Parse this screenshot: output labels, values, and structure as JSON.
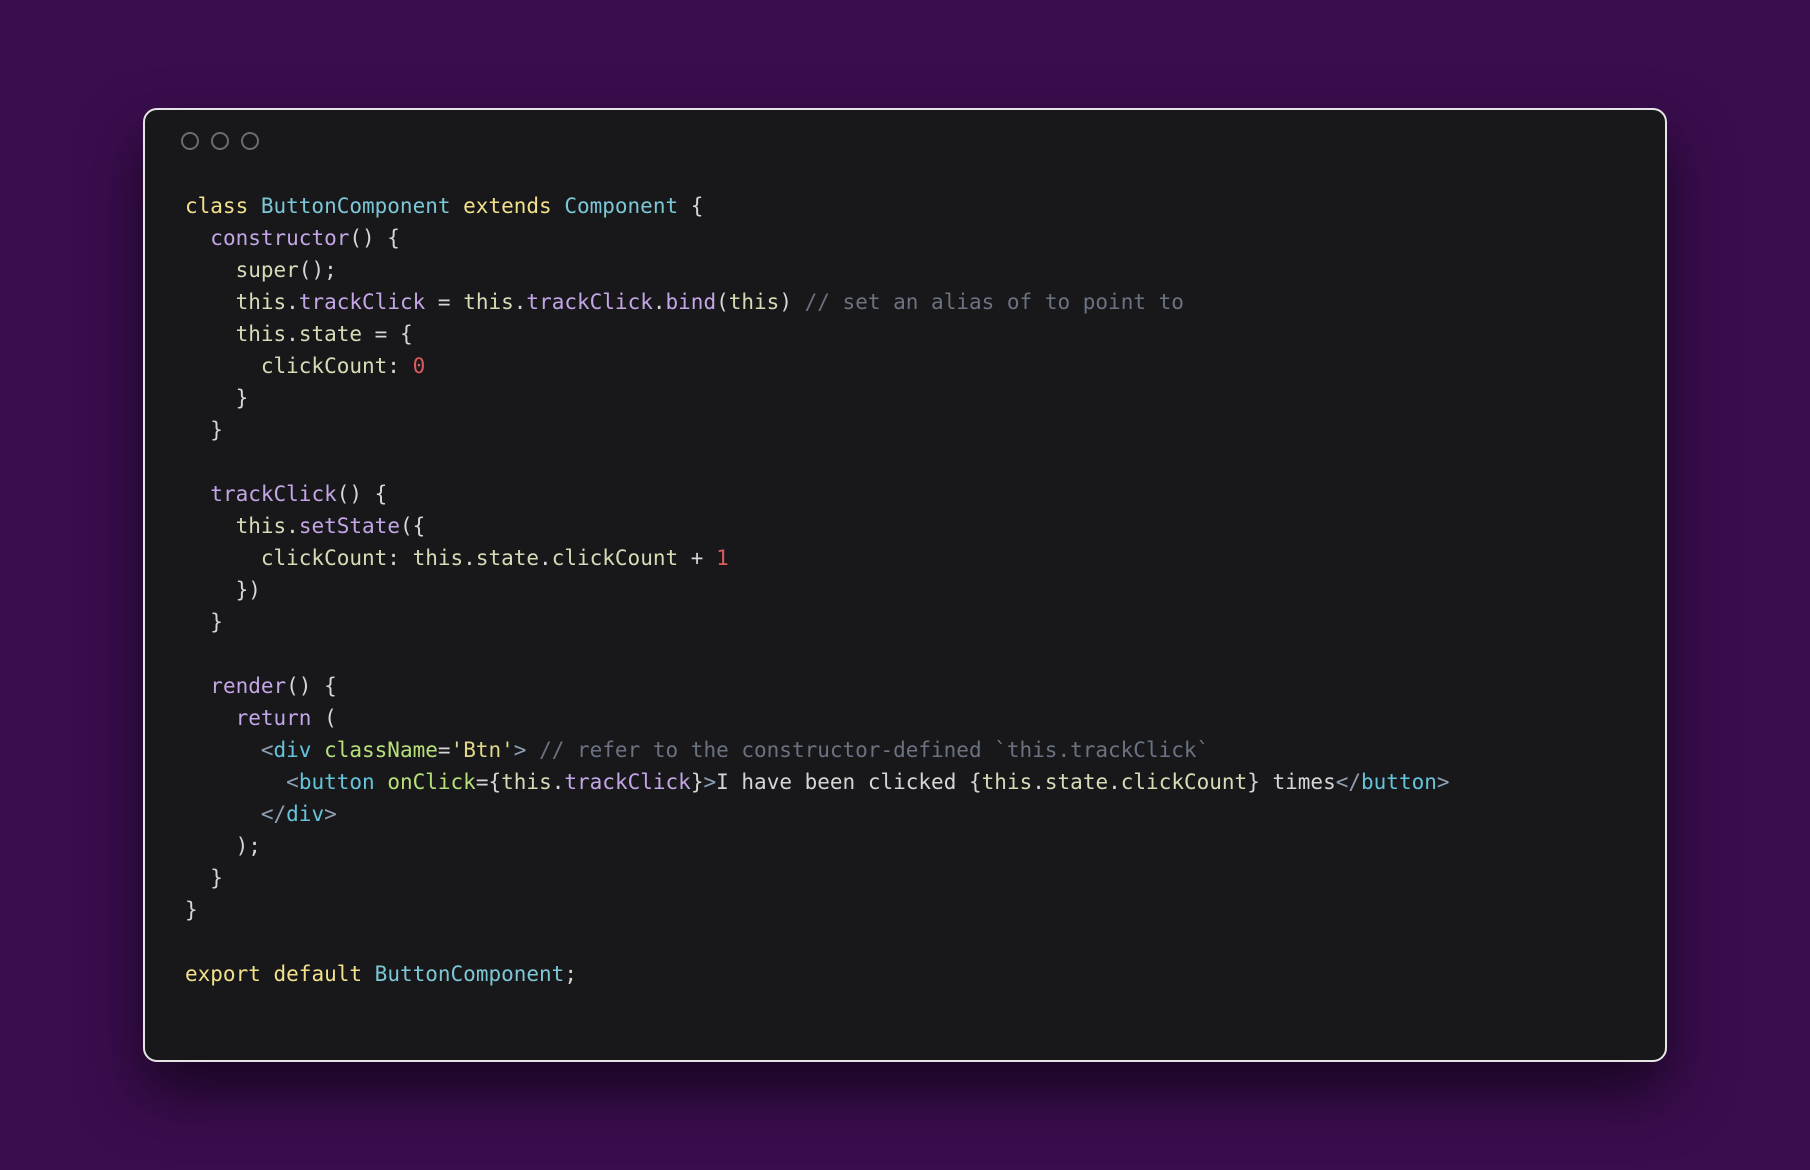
{
  "tokens": [
    {
      "t": "class ",
      "c": "kw-class"
    },
    {
      "t": "ButtonComponent ",
      "c": "type"
    },
    {
      "t": "extends ",
      "c": "kw-class"
    },
    {
      "t": "Component ",
      "c": "type"
    },
    {
      "t": "{",
      "c": "punc"
    },
    {
      "t": "\n",
      "c": ""
    },
    {
      "t": "  ",
      "c": ""
    },
    {
      "t": "constructor",
      "c": "kw-purple"
    },
    {
      "t": "() {",
      "c": "punc"
    },
    {
      "t": "\n",
      "c": ""
    },
    {
      "t": "    ",
      "c": ""
    },
    {
      "t": "super",
      "c": "id-pale"
    },
    {
      "t": "();",
      "c": "punc"
    },
    {
      "t": "\n",
      "c": ""
    },
    {
      "t": "    ",
      "c": ""
    },
    {
      "t": "this",
      "c": "id-pale"
    },
    {
      "t": ".",
      "c": "punc"
    },
    {
      "t": "trackClick",
      "c": "kw-purple"
    },
    {
      "t": " = ",
      "c": "punc"
    },
    {
      "t": "this",
      "c": "id-pale"
    },
    {
      "t": ".",
      "c": "punc"
    },
    {
      "t": "trackClick",
      "c": "kw-purple"
    },
    {
      "t": ".",
      "c": "punc"
    },
    {
      "t": "bind",
      "c": "kw-purple"
    },
    {
      "t": "(",
      "c": "punc"
    },
    {
      "t": "this",
      "c": "id-pale"
    },
    {
      "t": ") ",
      "c": "punc"
    },
    {
      "t": "// set an alias of to point to",
      "c": "comment"
    },
    {
      "t": "\n",
      "c": ""
    },
    {
      "t": "    ",
      "c": ""
    },
    {
      "t": "this",
      "c": "id-pale"
    },
    {
      "t": ".",
      "c": "punc"
    },
    {
      "t": "state",
      "c": "id-pale"
    },
    {
      "t": " = {",
      "c": "punc"
    },
    {
      "t": "\n",
      "c": ""
    },
    {
      "t": "      ",
      "c": ""
    },
    {
      "t": "clickCount",
      "c": "id-pale"
    },
    {
      "t": ": ",
      "c": "punc"
    },
    {
      "t": "0",
      "c": "num"
    },
    {
      "t": "\n",
      "c": ""
    },
    {
      "t": "    }",
      "c": "punc"
    },
    {
      "t": "\n",
      "c": ""
    },
    {
      "t": "  }",
      "c": "punc"
    },
    {
      "t": "\n",
      "c": ""
    },
    {
      "t": "\n",
      "c": ""
    },
    {
      "t": "  ",
      "c": ""
    },
    {
      "t": "trackClick",
      "c": "kw-purple"
    },
    {
      "t": "() {",
      "c": "punc"
    },
    {
      "t": "\n",
      "c": ""
    },
    {
      "t": "    ",
      "c": ""
    },
    {
      "t": "this",
      "c": "id-pale"
    },
    {
      "t": ".",
      "c": "punc"
    },
    {
      "t": "setState",
      "c": "kw-purple"
    },
    {
      "t": "({",
      "c": "punc"
    },
    {
      "t": "\n",
      "c": ""
    },
    {
      "t": "      ",
      "c": ""
    },
    {
      "t": "clickCount",
      "c": "id-pale"
    },
    {
      "t": ": ",
      "c": "punc"
    },
    {
      "t": "this",
      "c": "id-pale"
    },
    {
      "t": ".",
      "c": "punc"
    },
    {
      "t": "state",
      "c": "id-pale"
    },
    {
      "t": ".",
      "c": "punc"
    },
    {
      "t": "clickCount",
      "c": "id-pale"
    },
    {
      "t": " + ",
      "c": "punc"
    },
    {
      "t": "1",
      "c": "num"
    },
    {
      "t": "\n",
      "c": ""
    },
    {
      "t": "    })",
      "c": "punc"
    },
    {
      "t": "\n",
      "c": ""
    },
    {
      "t": "  }",
      "c": "punc"
    },
    {
      "t": "\n",
      "c": ""
    },
    {
      "t": "\n",
      "c": ""
    },
    {
      "t": "  ",
      "c": ""
    },
    {
      "t": "render",
      "c": "kw-purple"
    },
    {
      "t": "() {",
      "c": "punc"
    },
    {
      "t": "\n",
      "c": ""
    },
    {
      "t": "    ",
      "c": ""
    },
    {
      "t": "return ",
      "c": "kw-purple"
    },
    {
      "t": "(",
      "c": "punc"
    },
    {
      "t": "\n",
      "c": ""
    },
    {
      "t": "      ",
      "c": ""
    },
    {
      "t": "<",
      "c": "tag-angle"
    },
    {
      "t": "div ",
      "c": "tag"
    },
    {
      "t": "className",
      "c": "attr"
    },
    {
      "t": "=",
      "c": "punc"
    },
    {
      "t": "'Btn'",
      "c": "str"
    },
    {
      "t": ">",
      "c": "tag-angle"
    },
    {
      "t": " ",
      "c": ""
    },
    {
      "t": "// refer to the constructor-defined `this.trackClick`",
      "c": "comment"
    },
    {
      "t": "\n",
      "c": ""
    },
    {
      "t": "        ",
      "c": ""
    },
    {
      "t": "<",
      "c": "tag-angle"
    },
    {
      "t": "button ",
      "c": "tag"
    },
    {
      "t": "onClick",
      "c": "attr"
    },
    {
      "t": "={",
      "c": "punc"
    },
    {
      "t": "this",
      "c": "id-pale"
    },
    {
      "t": ".",
      "c": "punc"
    },
    {
      "t": "trackClick",
      "c": "kw-purple"
    },
    {
      "t": "}",
      "c": "punc"
    },
    {
      "t": ">",
      "c": "tag-angle"
    },
    {
      "t": "I have been clicked ",
      "c": "jsx-text"
    },
    {
      "t": "{",
      "c": "punc"
    },
    {
      "t": "this",
      "c": "id-pale"
    },
    {
      "t": ".",
      "c": "punc"
    },
    {
      "t": "state",
      "c": "id-pale"
    },
    {
      "t": ".",
      "c": "punc"
    },
    {
      "t": "clickCount",
      "c": "id-pale"
    },
    {
      "t": "}",
      "c": "punc"
    },
    {
      "t": " times",
      "c": "jsx-text"
    },
    {
      "t": "</",
      "c": "tag-angle"
    },
    {
      "t": "button",
      "c": "tag"
    },
    {
      "t": ">",
      "c": "tag-angle"
    },
    {
      "t": "\n",
      "c": ""
    },
    {
      "t": "      ",
      "c": ""
    },
    {
      "t": "</",
      "c": "tag-angle"
    },
    {
      "t": "div",
      "c": "tag"
    },
    {
      "t": ">",
      "c": "tag-angle"
    },
    {
      "t": "\n",
      "c": ""
    },
    {
      "t": "    );",
      "c": "punc"
    },
    {
      "t": "\n",
      "c": ""
    },
    {
      "t": "  }",
      "c": "punc"
    },
    {
      "t": "\n",
      "c": ""
    },
    {
      "t": "}",
      "c": "punc"
    },
    {
      "t": "\n",
      "c": ""
    },
    {
      "t": "\n",
      "c": ""
    },
    {
      "t": "export ",
      "c": "kw-class"
    },
    {
      "t": "default ",
      "c": "kw-class"
    },
    {
      "t": "ButtonComponent",
      "c": "type"
    },
    {
      "t": ";",
      "c": "punc"
    }
  ]
}
